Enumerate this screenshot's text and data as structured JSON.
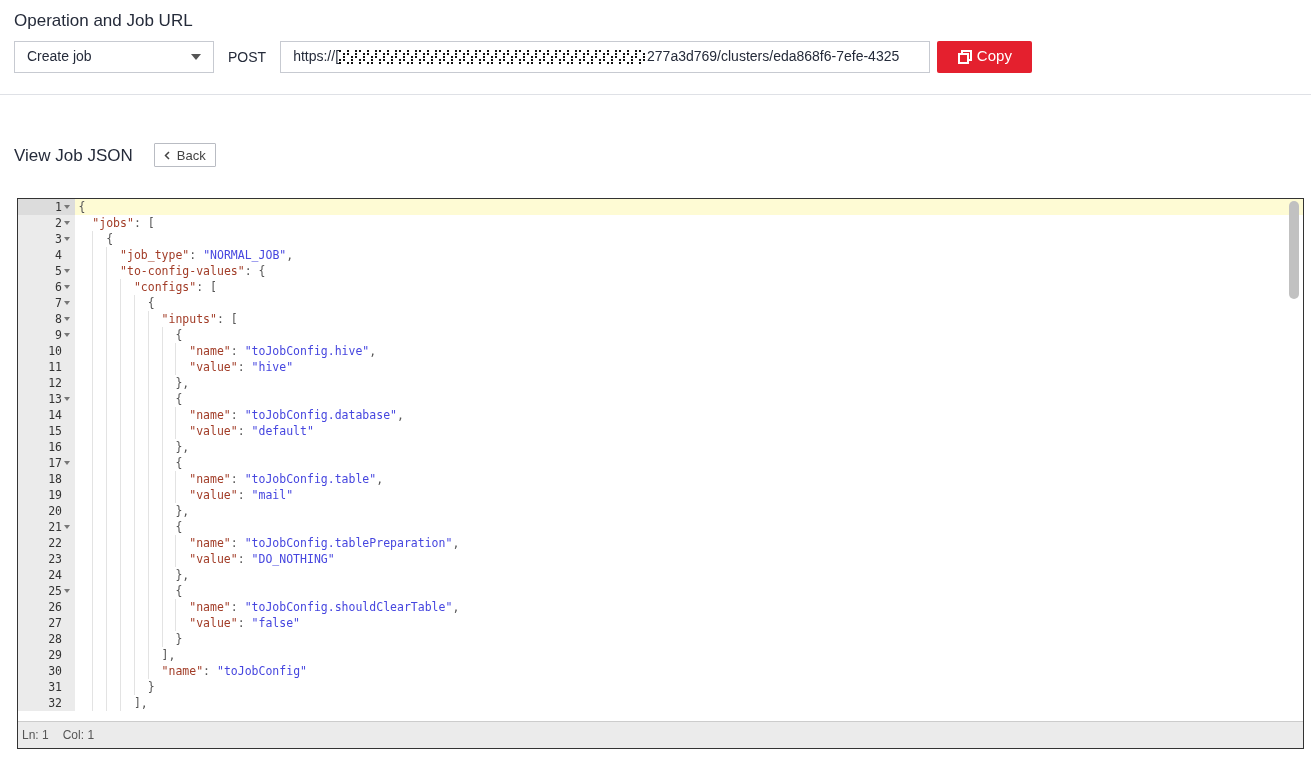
{
  "operation": {
    "title": "Operation and Job URL",
    "select_value": "Create job",
    "method": "POST",
    "url_prefix": "https://[",
    "url_suffix": "277a3d769/clusters/eda868f6-7efe-4325",
    "url_redacted": true,
    "copy_button": "Copy"
  },
  "job_json": {
    "title": "View Job JSON",
    "back_button": "Back",
    "editor": {
      "lines": [
        {
          "number": "1",
          "foldable": true,
          "selected": true,
          "code": "{"
        },
        {
          "number": "2",
          "foldable": true,
          "selected": false,
          "code": "  \"jobs\": ["
        },
        {
          "number": "3",
          "foldable": true,
          "selected": false,
          "code": "    {"
        },
        {
          "number": "4",
          "foldable": false,
          "selected": false,
          "code": "      \"job_type\": \"NORMAL_JOB\","
        },
        {
          "number": "5",
          "foldable": true,
          "selected": false,
          "code": "      \"to-config-values\": {"
        },
        {
          "number": "6",
          "foldable": true,
          "selected": false,
          "code": "        \"configs\": ["
        },
        {
          "number": "7",
          "foldable": true,
          "selected": false,
          "code": "          {"
        },
        {
          "number": "8",
          "foldable": true,
          "selected": false,
          "code": "            \"inputs\": ["
        },
        {
          "number": "9",
          "foldable": true,
          "selected": false,
          "code": "              {"
        },
        {
          "number": "10",
          "foldable": false,
          "selected": false,
          "code": "                \"name\": \"toJobConfig.hive\","
        },
        {
          "number": "11",
          "foldable": false,
          "selected": false,
          "code": "                \"value\": \"hive\""
        },
        {
          "number": "12",
          "foldable": false,
          "selected": false,
          "code": "              },"
        },
        {
          "number": "13",
          "foldable": true,
          "selected": false,
          "code": "              {"
        },
        {
          "number": "14",
          "foldable": false,
          "selected": false,
          "code": "                \"name\": \"toJobConfig.database\","
        },
        {
          "number": "15",
          "foldable": false,
          "selected": false,
          "code": "                \"value\": \"default\""
        },
        {
          "number": "16",
          "foldable": false,
          "selected": false,
          "code": "              },"
        },
        {
          "number": "17",
          "foldable": true,
          "selected": false,
          "code": "              {"
        },
        {
          "number": "18",
          "foldable": false,
          "selected": false,
          "code": "                \"name\": \"toJobConfig.table\","
        },
        {
          "number": "19",
          "foldable": false,
          "selected": false,
          "code": "                \"value\": \"mail\""
        },
        {
          "number": "20",
          "foldable": false,
          "selected": false,
          "code": "              },"
        },
        {
          "number": "21",
          "foldable": true,
          "selected": false,
          "code": "              {"
        },
        {
          "number": "22",
          "foldable": false,
          "selected": false,
          "code": "                \"name\": \"toJobConfig.tablePreparation\","
        },
        {
          "number": "23",
          "foldable": false,
          "selected": false,
          "code": "                \"value\": \"DO_NOTHING\""
        },
        {
          "number": "24",
          "foldable": false,
          "selected": false,
          "code": "              },"
        },
        {
          "number": "25",
          "foldable": true,
          "selected": false,
          "code": "              {"
        },
        {
          "number": "26",
          "foldable": false,
          "selected": false,
          "code": "                \"name\": \"toJobConfig.shouldClearTable\","
        },
        {
          "number": "27",
          "foldable": false,
          "selected": false,
          "code": "                \"value\": \"false\""
        },
        {
          "number": "28",
          "foldable": false,
          "selected": false,
          "code": "              }"
        },
        {
          "number": "29",
          "foldable": false,
          "selected": false,
          "code": "            ],"
        },
        {
          "number": "30",
          "foldable": false,
          "selected": false,
          "code": "            \"name\": \"toJobConfig\""
        },
        {
          "number": "31",
          "foldable": false,
          "selected": false,
          "code": "          }"
        },
        {
          "number": "32",
          "foldable": false,
          "selected": false,
          "code": "        ],"
        }
      ],
      "status_line": "Ln: 1",
      "status_col": "Col: 1"
    }
  }
}
